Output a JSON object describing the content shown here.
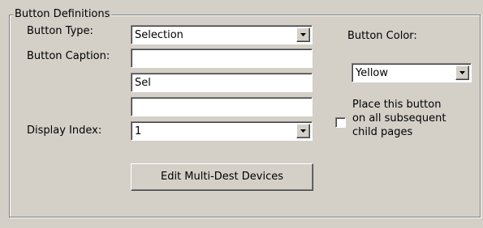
{
  "group": {
    "title": "Button Definitions"
  },
  "button_type": {
    "label": "Button Type:",
    "value": "Selection"
  },
  "button_caption": {
    "label": "Button Caption:",
    "line1": "",
    "line2": "Sel",
    "line3": ""
  },
  "display_index": {
    "label": "Display Index:",
    "value": "1"
  },
  "edit_multi_dest": {
    "label": "Edit Multi-Dest Devices"
  },
  "button_color": {
    "label": "Button Color:",
    "value": "Yellow"
  },
  "place_on_subsequent": {
    "line1": "Place this button",
    "line2": "on all subsequent",
    "line3": "child pages",
    "checked": false
  },
  "icons": {
    "dropdown": "chevron-down-icon"
  }
}
